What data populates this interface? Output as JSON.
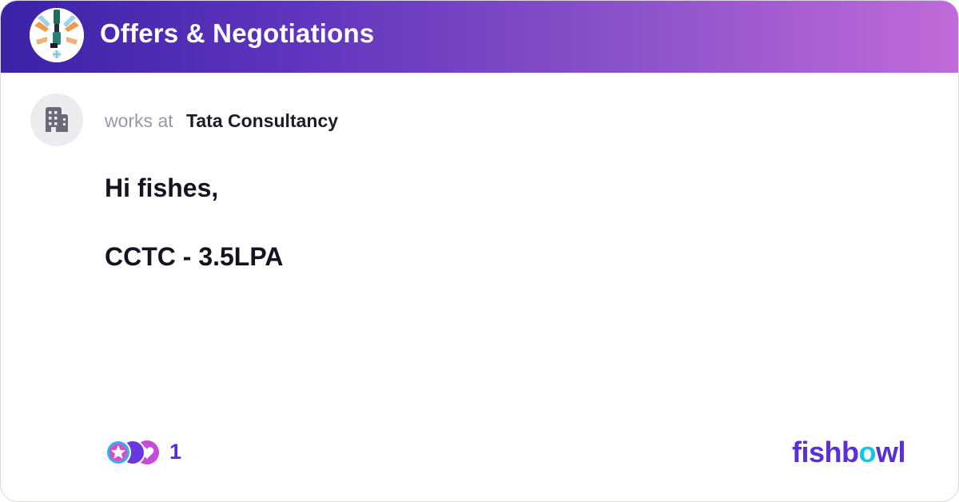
{
  "header": {
    "bowl_title": "Offers & Negotiations",
    "bowl_icon": "bowl-avatar-icon"
  },
  "author": {
    "avatar_icon": "building-icon",
    "works_at_label": "works at",
    "company": "Tata Consultancy"
  },
  "post": {
    "line1": "Hi fishes,",
    "line2": "CCTC - 3.5LPA"
  },
  "reactions": {
    "icons": [
      "star-reaction-icon",
      "moon-reaction-icon",
      "heart-reaction-icon"
    ],
    "count": "1"
  },
  "brand": {
    "part1": "fishb",
    "part2": "o",
    "part3": "wl"
  },
  "colors": {
    "header_gradient_start": "#3b22a6",
    "header_gradient_end": "#c06ad8",
    "accent_purple": "#5b2bd1",
    "accent_cyan": "#16c6e8"
  }
}
